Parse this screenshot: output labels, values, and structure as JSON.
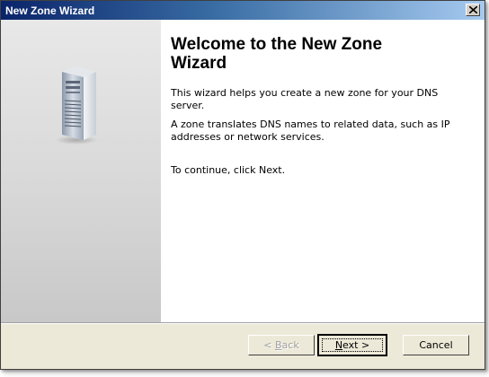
{
  "window": {
    "title": "New Zone Wizard"
  },
  "main": {
    "heading": "Welcome to the New Zone Wizard",
    "paragraph1": "This wizard helps you create a new zone for your DNS server.",
    "paragraph2": "A zone translates DNS names to related data, such as IP addresses or network services.",
    "paragraph3": "To continue, click Next."
  },
  "buttons": {
    "back": {
      "prefix": "< ",
      "mnemonic": "B",
      "rest": "ack"
    },
    "next": {
      "mnemonic": "N",
      "rest": "ext >"
    },
    "cancel": "Cancel"
  },
  "icons": {
    "close": "close-icon",
    "server": "server-icon"
  },
  "colors": {
    "titlebar_start": "#0a246a",
    "titlebar_end": "#a6caf0",
    "dialog_face": "#ece9d8"
  }
}
